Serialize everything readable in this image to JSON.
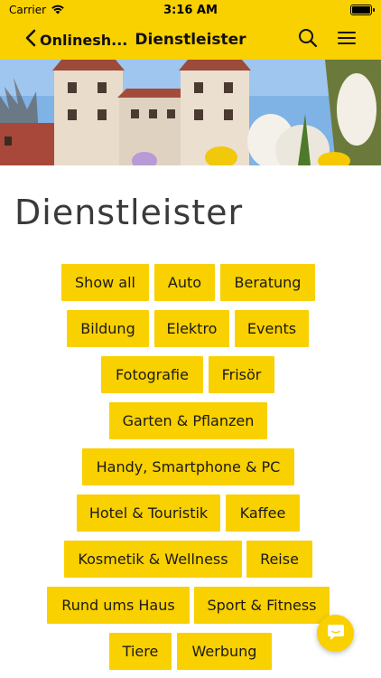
{
  "status_bar": {
    "carrier": "Carrier",
    "time": "3:16 AM",
    "wifi_icon": "wifi-icon",
    "battery_icon": "battery-icon"
  },
  "nav": {
    "back_label": "Onlinesh...",
    "title": "Dienstleister",
    "back_icon": "chevron-left-icon",
    "search_icon": "search-icon",
    "menu_icon": "hamburger-menu-icon"
  },
  "hero": {
    "description_icon": "header-photo"
  },
  "page": {
    "title": "Dienstleister"
  },
  "categories": [
    "Show all",
    "Auto",
    "Beratung",
    "Bildung",
    "Elektro",
    "Events",
    "Fotografie",
    "Frisör",
    "Garten & Pflanzen",
    "Handy, Smartphone & PC",
    "Hotel & Touristik",
    "Kaffee",
    "Kosmetik & Wellness",
    "Reise",
    "Rund ums Haus",
    "Sport & Fitness",
    "Tiere",
    "Werbung"
  ],
  "chat": {
    "icon": "chat-bubble-icon"
  },
  "colors": {
    "accent": "#f9d000",
    "title_text": "#3a3a3a"
  }
}
